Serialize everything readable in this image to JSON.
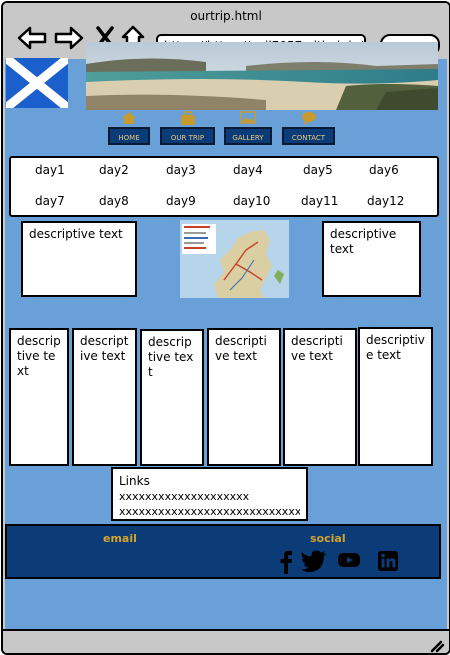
{
  "window": {
    "title": "ourtrip.html",
    "url": "https://https://neil7057.github.io/"
  },
  "nav": [
    {
      "label": "HOME",
      "icon": "home-icon"
    },
    {
      "label": "OUR TRIP",
      "icon": "luggage-icon"
    },
    {
      "label": "GALLERY",
      "icon": "image-icon"
    },
    {
      "label": "CONTACT",
      "icon": "chat-icon"
    }
  ],
  "days": [
    "day1",
    "day2",
    "day3",
    "day4",
    "day5",
    "day6",
    "day7",
    "day8",
    "day9",
    "day10",
    "day11",
    "day12"
  ],
  "descriptive": {
    "left": "descriptive text",
    "right": "descriptive text",
    "cols": [
      "descriptive text",
      "descriptive text",
      "descriptive text",
      "descriptive text",
      "descriptive text",
      "descriptive text"
    ]
  },
  "links": {
    "title": "Links",
    "line1": "xxxxxxxxxxxxxxxxxxxx",
    "line2": "xxxxxxxxxxxxxxxxxxxxxxxxxxxxx"
  },
  "footer": {
    "email": "email",
    "social": "social",
    "icons": [
      "facebook-icon",
      "twitter-icon",
      "youtube-icon",
      "linkedin-icon"
    ]
  },
  "colors": {
    "page_bg": "#6aa0d8",
    "nav_bg": "#0b3c78",
    "accent": "#d4a52a",
    "chrome": "#c8c8c8"
  }
}
